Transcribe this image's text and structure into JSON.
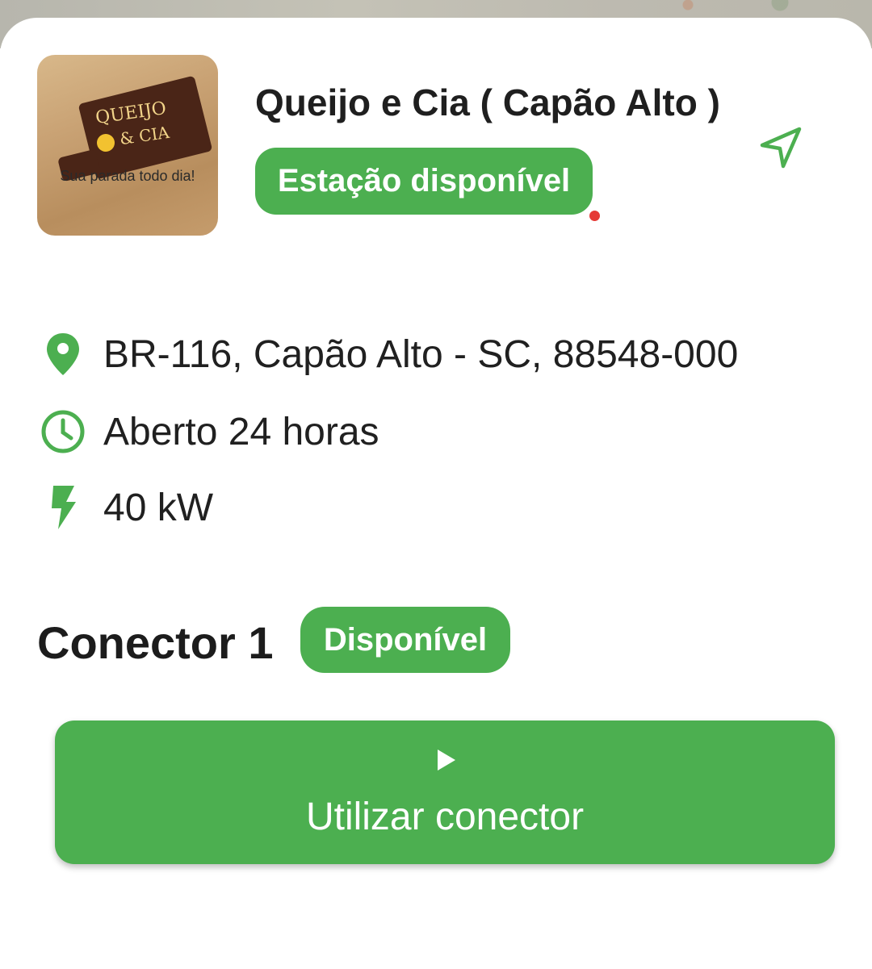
{
  "station": {
    "name": "Queijo e Cia ( Capão Alto )",
    "status": "Estação disponível",
    "logo": {
      "line1": "QUEIJO",
      "line2": "& CIA",
      "slogan": "Sua parada todo dia!"
    }
  },
  "info": {
    "address": "BR-116, Capão Alto - SC, 88548-000",
    "hours": "Aberto 24 horas",
    "power": "40 kW"
  },
  "connector": {
    "title": "Conector 1",
    "status": "Disponível",
    "button_label": "Utilizar conector"
  },
  "icons": {
    "navigate": "navigation-arrow-icon",
    "address": "location-pin-icon",
    "hours": "clock-icon",
    "power": "lightning-bolt-icon",
    "button": "play-icon"
  },
  "colors": {
    "accent": "#4caf50",
    "text": "#202020",
    "indicator": "#e53935"
  }
}
